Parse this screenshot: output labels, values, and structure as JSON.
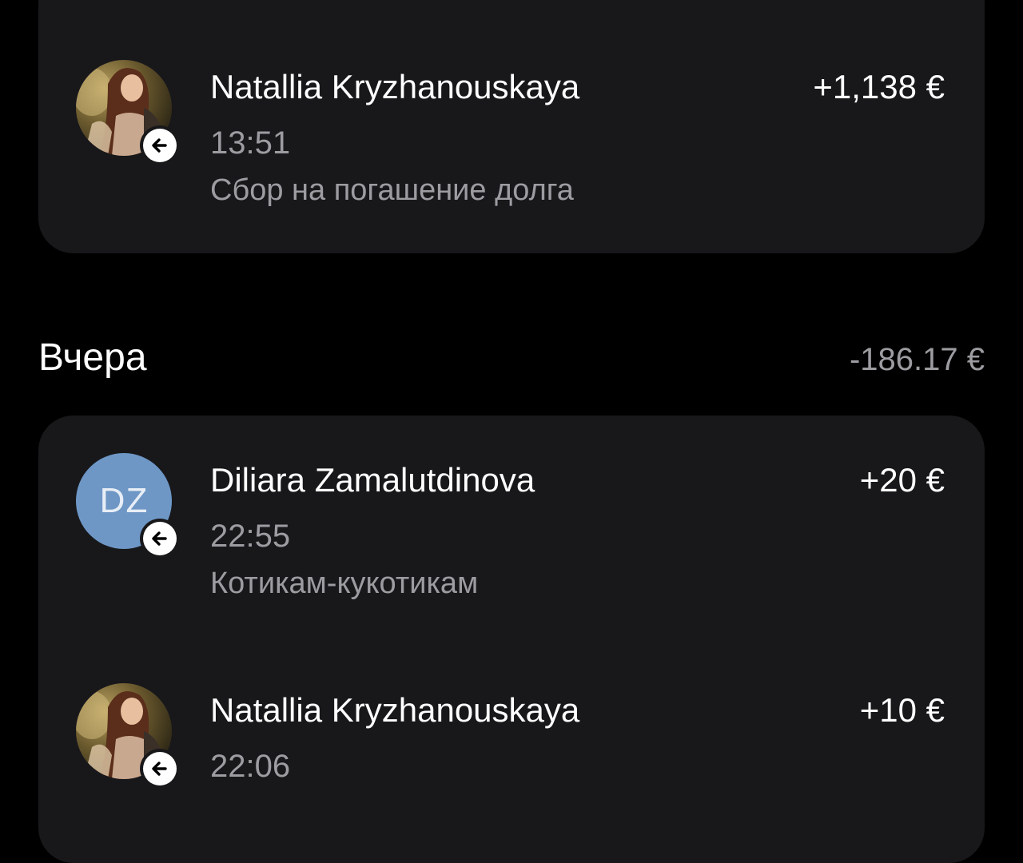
{
  "top_card": {
    "transaction": {
      "name": "Natallia Kryzhanouskaya",
      "amount": "+1,138 €",
      "time": "13:51",
      "note": "Сбор на погашение долга",
      "avatar": "photo",
      "direction_icon": "arrow-left-icon"
    }
  },
  "section": {
    "title": "Вчера",
    "total": "-186.17 €"
  },
  "bottom_card": {
    "transactions": [
      {
        "name": "Diliara Zamalutdinova",
        "amount": "+20 €",
        "time": "22:55",
        "note": "Котикам-кукотикам",
        "avatar_initials": "DZ",
        "avatar_color": "#6e97c6",
        "direction_icon": "arrow-left-icon"
      },
      {
        "name": "Natallia Kryzhanouskaya",
        "amount": "+10 €",
        "time": "22:06",
        "avatar": "photo",
        "direction_icon": "arrow-left-icon"
      }
    ]
  },
  "colors": {
    "background": "#000000",
    "card": "#18181b",
    "secondary_text": "#9c9ca1"
  }
}
